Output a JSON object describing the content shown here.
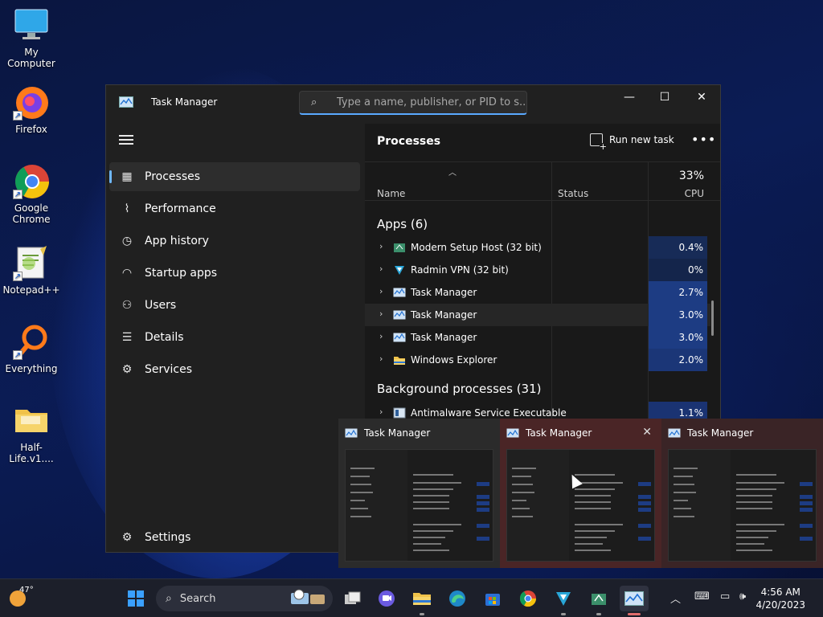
{
  "desktop": {
    "icons": [
      {
        "label": "My Computer",
        "icon": "monitor-icon"
      },
      {
        "label": "Firefox",
        "icon": "firefox-icon"
      },
      {
        "label": "Google Chrome",
        "icon": "chrome-icon"
      },
      {
        "label": "Notepad++",
        "icon": "notepadpp-icon"
      },
      {
        "label": "Everything",
        "icon": "everything-search-icon"
      },
      {
        "label": "Half-Life.v1....",
        "icon": "folder-icon"
      }
    ]
  },
  "window": {
    "title": "Task Manager",
    "search_placeholder": "Type a name, publisher, or PID to s...",
    "controls": {
      "minimize": "—",
      "maximize": "☐",
      "close": "✕"
    }
  },
  "sidebar": {
    "items": [
      {
        "label": "Processes",
        "icon": "processes-icon",
        "active": true
      },
      {
        "label": "Performance",
        "icon": "performance-icon"
      },
      {
        "label": "App history",
        "icon": "history-icon"
      },
      {
        "label": "Startup apps",
        "icon": "startup-icon"
      },
      {
        "label": "Users",
        "icon": "users-icon"
      },
      {
        "label": "Details",
        "icon": "details-icon"
      },
      {
        "label": "Services",
        "icon": "services-icon"
      }
    ],
    "settings": "Settings"
  },
  "main": {
    "title": "Processes",
    "run_new_task": "Run new task",
    "more": "•••",
    "columns": {
      "name": "Name",
      "status": "Status",
      "cpu_pct": "33%",
      "cpu": "CPU"
    },
    "apps_group": "Apps (6)",
    "background_group": "Background processes (31)",
    "apps": [
      {
        "name": "Modern Setup Host (32 bit)",
        "cpu": "0.4%",
        "icon": "setup-host-icon"
      },
      {
        "name": "Radmin VPN (32 bit)",
        "cpu": "0%",
        "icon": "radmin-vpn-icon"
      },
      {
        "name": "Task Manager",
        "cpu": "2.7%",
        "icon": "task-manager-icon"
      },
      {
        "name": "Task Manager",
        "cpu": "3.0%",
        "icon": "task-manager-icon"
      },
      {
        "name": "Task Manager",
        "cpu": "3.0%",
        "icon": "task-manager-icon"
      },
      {
        "name": "Windows Explorer",
        "cpu": "2.0%",
        "icon": "explorer-folder-icon"
      }
    ],
    "background": [
      {
        "name": "Antimalware Service Executable",
        "cpu": "1.1%",
        "icon": "antimalware-icon"
      }
    ]
  },
  "thumbnails": [
    {
      "title": "Task Manager"
    },
    {
      "title": "Task Manager",
      "close": "✕"
    },
    {
      "title": "Task Manager"
    }
  ],
  "taskbar": {
    "weather_temp": "47°",
    "search_label": "Search",
    "tray_time": "4:56 AM",
    "tray_date": "4/20/2023",
    "apps": [
      "start-icon",
      "task-view-icon",
      "chat-icon",
      "file-explorer-icon",
      "edge-icon",
      "store-icon",
      "chrome-icon",
      "radmin-vpn-icon",
      "setup-host-icon",
      "task-manager-icon"
    ]
  },
  "colors": {
    "accent": "#6fb8ff",
    "cpu_heat": "#1d3c83",
    "thumb_hover": "#4a2526"
  }
}
